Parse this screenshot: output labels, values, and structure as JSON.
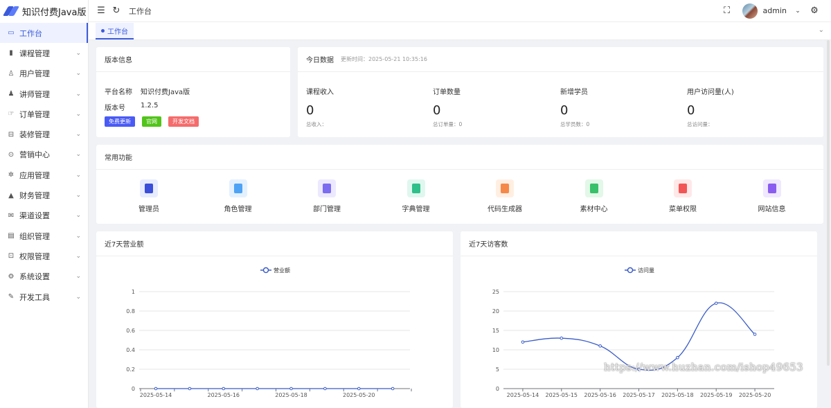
{
  "app": {
    "title": "知识付费Java版"
  },
  "sidebar": {
    "items": [
      {
        "label": "工作台",
        "icon": "monitor-icon",
        "glyph": "▭",
        "active": true,
        "caret": false
      },
      {
        "label": "课程管理",
        "icon": "book-icon",
        "glyph": "▮",
        "caret": true
      },
      {
        "label": "用户管理",
        "icon": "user-icon",
        "glyph": "♙",
        "caret": true
      },
      {
        "label": "讲师管理",
        "icon": "teacher-icon",
        "glyph": "♟",
        "caret": true
      },
      {
        "label": "订单管理",
        "icon": "order-icon",
        "glyph": "☞",
        "caret": true
      },
      {
        "label": "装修管理",
        "icon": "decoration-icon",
        "glyph": "⊟",
        "caret": true
      },
      {
        "label": "营销中心",
        "icon": "marketing-icon",
        "glyph": "⊙",
        "caret": true
      },
      {
        "label": "应用管理",
        "icon": "app-icon",
        "glyph": "✲",
        "caret": true
      },
      {
        "label": "财务管理",
        "icon": "finance-icon",
        "glyph": "▲",
        "caret": true
      },
      {
        "label": "渠道设置",
        "icon": "mail-icon",
        "glyph": "✉",
        "caret": true
      },
      {
        "label": "组织管理",
        "icon": "organization-icon",
        "glyph": "▤",
        "caret": true
      },
      {
        "label": "权限管理",
        "icon": "lock-icon",
        "glyph": "⊡",
        "caret": true
      },
      {
        "label": "系统设置",
        "icon": "settings-icon",
        "glyph": "⚙",
        "caret": true
      },
      {
        "label": "开发工具",
        "icon": "pen-icon",
        "glyph": "✎",
        "caret": true
      }
    ]
  },
  "header": {
    "breadcrumb": "工作台",
    "user": "admin"
  },
  "tabs": [
    {
      "label": "工作台"
    }
  ],
  "version_card": {
    "title": "版本信息",
    "platform_key": "平台名称",
    "platform_value": "知识付费Java版",
    "version_key": "版本号",
    "version_value": "1.2.5",
    "buttons": [
      {
        "label": "免费更新",
        "color": "#4a5bf5"
      },
      {
        "label": "官网",
        "color": "#52c41a"
      },
      {
        "label": "开发文档",
        "color": "#f56c6c"
      }
    ]
  },
  "today_card": {
    "title": "今日数据",
    "update_time": "更新时间：2025-05-21 10:35:16",
    "stats": [
      {
        "title": "课程收入",
        "value": "0",
        "sub": "总收入："
      },
      {
        "title": "订单数量",
        "value": "0",
        "sub": "总订单量：0"
      },
      {
        "title": "新增学员",
        "value": "0",
        "sub": "总学员数：0"
      },
      {
        "title": "用户访问量(人)",
        "value": "0",
        "sub": "总访问量："
      }
    ]
  },
  "functions_card": {
    "title": "常用功能",
    "items": [
      {
        "label": "管理员",
        "icon": "admin-icon",
        "bg": "#e8ecff",
        "fg": "#3b4fd8"
      },
      {
        "label": "角色管理",
        "icon": "role-icon",
        "bg": "#e3f1ff",
        "fg": "#4ea3f5"
      },
      {
        "label": "部门管理",
        "icon": "department-icon",
        "bg": "#ece9ff",
        "fg": "#7b6cf0"
      },
      {
        "label": "字典管理",
        "icon": "dictionary-icon",
        "bg": "#e0f7ef",
        "fg": "#2fbf8a"
      },
      {
        "label": "代码生成器",
        "icon": "code-generator-icon",
        "bg": "#ffefe2",
        "fg": "#f5894a"
      },
      {
        "label": "素材中心",
        "icon": "material-icon",
        "bg": "#e3f8e8",
        "fg": "#39c06a"
      },
      {
        "label": "菜单权限",
        "icon": "menu-permission-icon",
        "bg": "#ffe8e8",
        "fg": "#f25555"
      },
      {
        "label": "网站信息",
        "icon": "website-info-icon",
        "bg": "#efe8ff",
        "fg": "#8a5cf0"
      }
    ]
  },
  "revenue_card": {
    "title": "近7天营业额"
  },
  "visitors_card": {
    "title": "近7天访客数"
  },
  "chart_data": [
    {
      "type": "line",
      "title": "近7天营业额",
      "series": [
        {
          "name": "营业额",
          "values": [
            0,
            0,
            0,
            0,
            0,
            0,
            0,
            0
          ]
        }
      ],
      "x_ticks": [
        "2025-05-14",
        "2025-05-16",
        "2025-05-18",
        "2025-05-20"
      ],
      "y_ticks": [
        "0",
        "0.2",
        "0.4",
        "0.6",
        "0.8",
        "1"
      ],
      "ylim": [
        0,
        1
      ],
      "color": "#3a5cc7"
    },
    {
      "type": "line",
      "title": "近7天访客数",
      "categories": [
        "2025-05-14",
        "2025-05-15",
        "2025-05-16",
        "2025-05-17",
        "2025-05-18",
        "2025-05-19",
        "2025-05-20"
      ],
      "series": [
        {
          "name": "访问量",
          "values": [
            12,
            13,
            11,
            5,
            8,
            22,
            14
          ]
        }
      ],
      "y_ticks": [
        "0",
        "5",
        "10",
        "15",
        "20",
        "25"
      ],
      "ylim": [
        0,
        25
      ],
      "color": "#3a5cc7"
    }
  ],
  "watermark": "https://www.huzhan.com/ishop49653"
}
